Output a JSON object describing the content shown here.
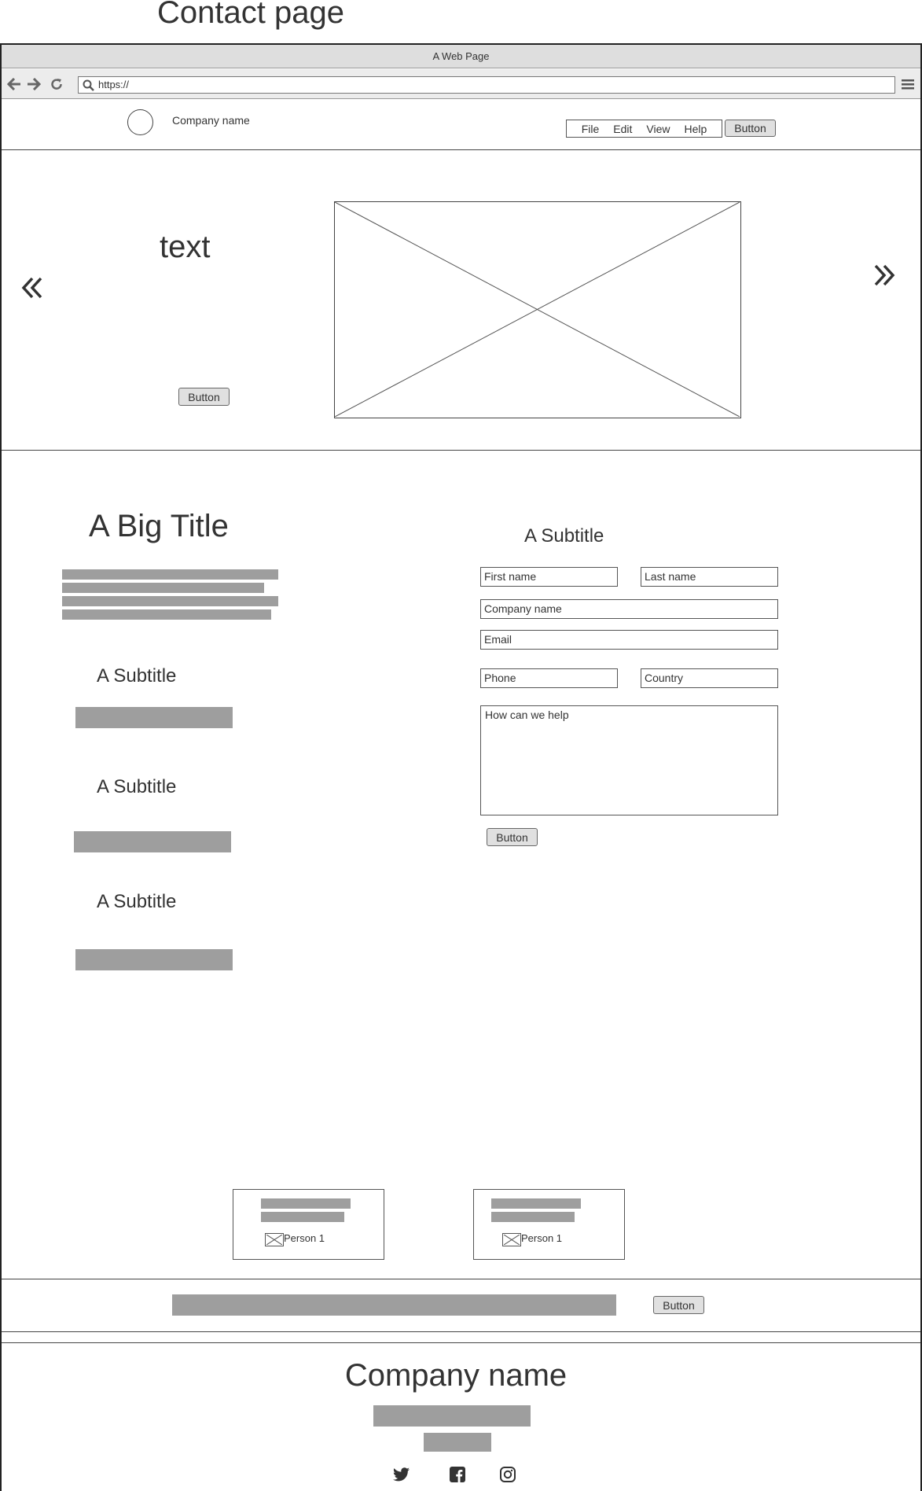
{
  "page_title": "Contact page",
  "browser": {
    "window_title": "A Web Page",
    "address": "https://"
  },
  "header": {
    "company_name": "Company name",
    "menu": [
      "File",
      "Edit",
      "View",
      "Help"
    ],
    "button_label": "Button"
  },
  "hero": {
    "text": "text",
    "button_label": "Button"
  },
  "main": {
    "big_title": "A Big Title",
    "left_subtitles": [
      "A Subtitle",
      "A Subtitle",
      "A Subtitle"
    ],
    "form": {
      "subtitle": "A Subtitle",
      "first_name": "First name",
      "last_name": "Last name",
      "company_name": "Company name",
      "email": "Email",
      "phone": "Phone",
      "country": "Country",
      "message": "How can we help",
      "button_label": "Button"
    },
    "cards": [
      {
        "person": "Person 1"
      },
      {
        "person": "Person 1"
      }
    ]
  },
  "newsletter": {
    "button_label": "Button"
  },
  "footer": {
    "company_name": "Company name",
    "social_icons": [
      "twitter-icon",
      "facebook-icon",
      "instagram-icon"
    ]
  }
}
